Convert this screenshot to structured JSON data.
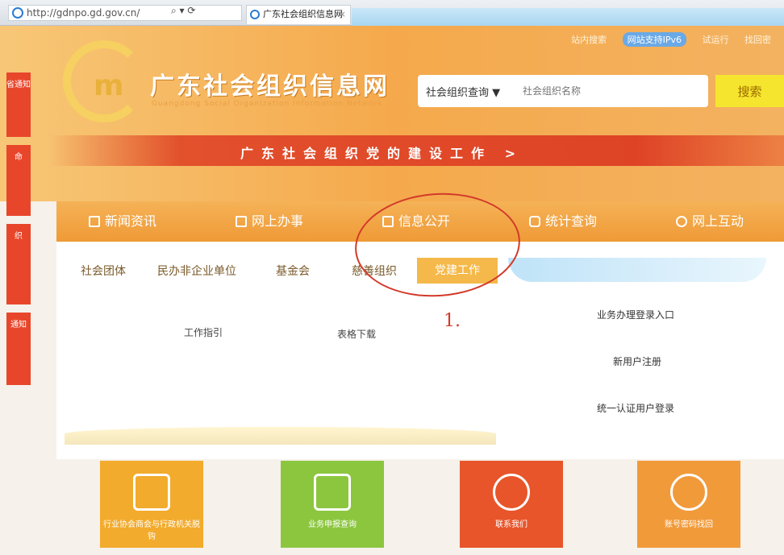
{
  "browser": {
    "url": "http://gdnpo.gd.gov.cn/",
    "tab_title": "广东社会组织信息网"
  },
  "header": {
    "top_links": [
      "站内搜索",
      "网站支持IPv6",
      "试运行",
      "找回密"
    ],
    "site_title": "广东社会组织信息网",
    "site_subtitle": "Guangdong Social Organization Information Network",
    "search": {
      "select_value": "社会组织查询",
      "placeholder": "社会组织名称",
      "button_label": "搜索"
    },
    "party_banner": "广东社会组织党的建设工作 >"
  },
  "sidebar": {
    "tiles": [
      "省通知",
      "命",
      "织",
      "通知"
    ]
  },
  "nav": {
    "items": [
      "新闻资讯",
      "网上办事",
      "信息公开",
      "统计查询",
      "网上互动"
    ]
  },
  "panel": {
    "subtabs": [
      "社会团体",
      "民办非企业单位",
      "基金会",
      "慈善组织",
      "党建工作"
    ],
    "active_subtab": "党建工作",
    "links": [
      "工作指引",
      "表格下载"
    ],
    "right_links": [
      "业务办理登录入口",
      "新用户注册",
      "统一认证用户登录"
    ]
  },
  "annotation": {
    "mark": "1."
  },
  "tiles": [
    {
      "label": "行业协会商会与行政机关脱钩",
      "color": "#f2ab2c",
      "icon": "document-icon"
    },
    {
      "label": "业务申报查询",
      "color": "#8cc63f",
      "icon": "message-icon"
    },
    {
      "label": "联系我们",
      "color": "#e8552a",
      "icon": "phone-icon"
    },
    {
      "label": "账号密码找回",
      "color": "#f19a3a",
      "icon": "user-lock-icon"
    }
  ]
}
